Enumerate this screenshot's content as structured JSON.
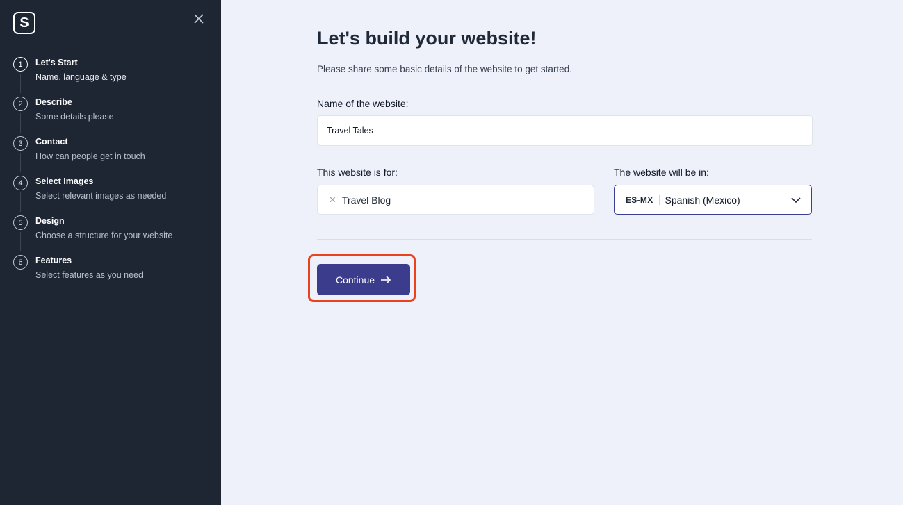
{
  "sidebar": {
    "logo_letter": "S",
    "steps": [
      {
        "num": "1",
        "title": "Let's Start",
        "desc": "Name, language & type"
      },
      {
        "num": "2",
        "title": "Describe",
        "desc": "Some details please"
      },
      {
        "num": "3",
        "title": "Contact",
        "desc": "How can people get in touch"
      },
      {
        "num": "4",
        "title": "Select Images",
        "desc": "Select relevant images as needed"
      },
      {
        "num": "5",
        "title": "Design",
        "desc": "Choose a structure for your website"
      },
      {
        "num": "6",
        "title": "Features",
        "desc": "Select features as you need"
      }
    ]
  },
  "main": {
    "title": "Let's build your website!",
    "subtitle": "Please share some basic details of the website to get started.",
    "name_label": "Name of the website:",
    "name_value": "Travel Tales",
    "type_label": "This website is for:",
    "type_tag": "Travel Blog",
    "lang_label": "The website will be in:",
    "lang_code": "ES-MX",
    "lang_name": "Spanish (Mexico)",
    "continue_label": "Continue"
  },
  "colors": {
    "sidebar_bg": "#1e2634",
    "page_bg": "#eef1fa",
    "primary": "#3b3d8c",
    "highlight": "#e9421c"
  }
}
